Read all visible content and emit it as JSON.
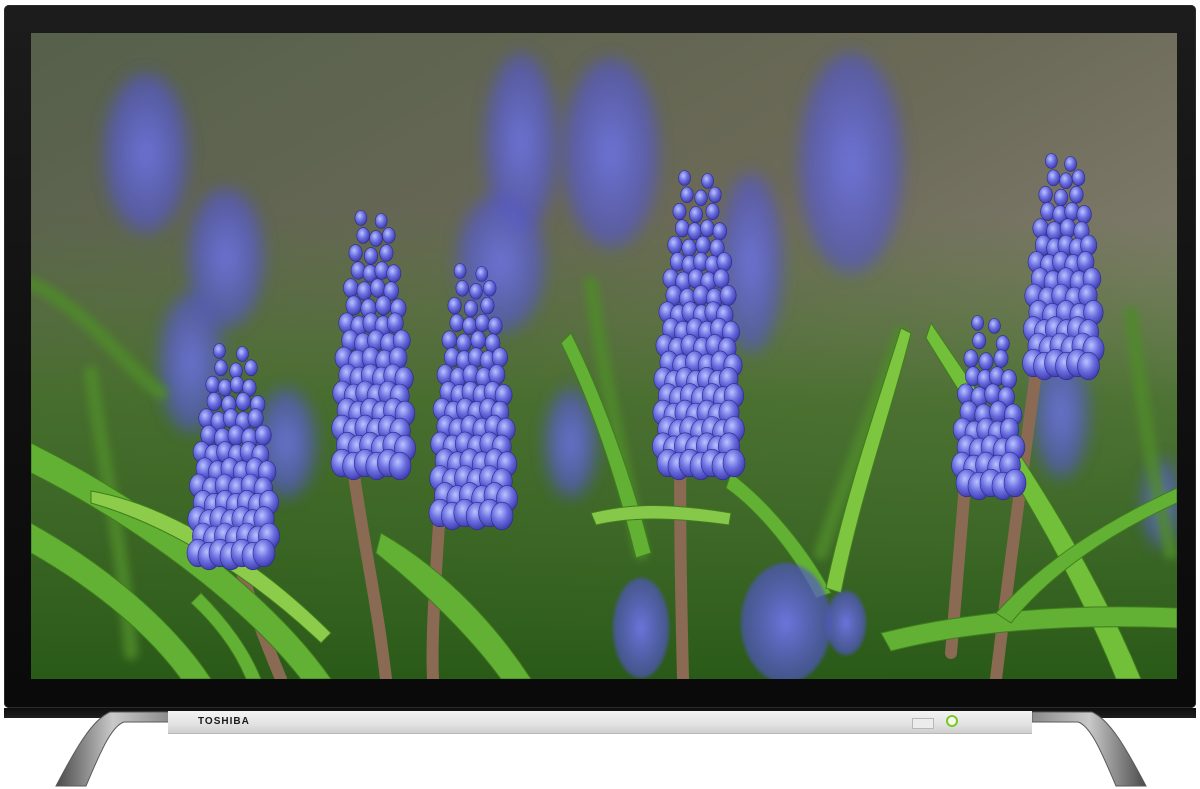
{
  "device": {
    "brand_label": "TOSHIBA",
    "type": "LED television",
    "screen_content": {
      "subject": "grape-hyacinth-flowers"
    }
  },
  "colors": {
    "bezel": "#111111",
    "flower_purple": "#5a5cd6",
    "grass_green": "#5fa431",
    "background_blur": "#4a5a3c",
    "stand_silver": "#bdbdbd",
    "power_led": "#7cc72b"
  },
  "icons": {
    "power_indicator": "power-led-icon",
    "ir_sensor": "ir-sensor-icon"
  }
}
